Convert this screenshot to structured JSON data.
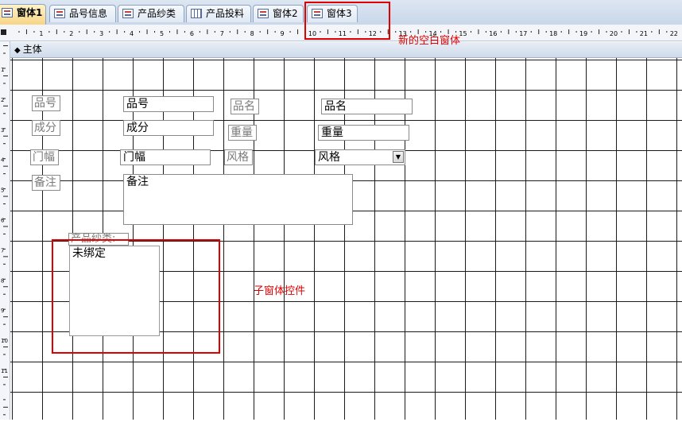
{
  "tabs": [
    {
      "label": "窗体1",
      "icon": "form-icon",
      "active": true
    },
    {
      "label": "品号信息",
      "icon": "form-icon",
      "active": false
    },
    {
      "label": "产品纱类",
      "icon": "form-icon",
      "active": false
    },
    {
      "label": "产品投料",
      "icon": "table-icon",
      "active": false
    },
    {
      "label": "窗体2",
      "icon": "form-icon",
      "active": false
    },
    {
      "label": "窗体3",
      "icon": "form-icon",
      "active": false
    }
  ],
  "ruler": {
    "ticks": [
      "1",
      "2",
      "3",
      "4",
      "5",
      "6",
      "7",
      "8",
      "9",
      "10",
      "11",
      "12",
      "13",
      "14",
      "15",
      "16",
      "17",
      "18",
      "19",
      "20",
      "21",
      "22"
    ],
    "vticks": [
      "1",
      "2",
      "3",
      "4",
      "5",
      "6",
      "7",
      "8",
      "9",
      "10",
      "11"
    ]
  },
  "section": {
    "label": "主体"
  },
  "form": {
    "labels": {
      "pinhao": "品号",
      "chengfen": "成分",
      "menfu": "门幅",
      "beizhu": "备注",
      "pinming": "品名",
      "zhongliang": "重量",
      "fengge": "风格"
    },
    "fields": {
      "pinhao": "品号",
      "chengfen": "成分",
      "menfu": "门幅",
      "beizhu": "备注",
      "pinming": "品名",
      "zhongliang": "重量",
      "fengge": "风格"
    },
    "subform": {
      "label": "产品纱类:",
      "content": "未绑定"
    }
  },
  "annotations": {
    "new_form": "新的空白窗体",
    "subform_control": "子窗体控件"
  },
  "colors": {
    "annotation": "#e00000",
    "active_tab": "#f7d486"
  }
}
